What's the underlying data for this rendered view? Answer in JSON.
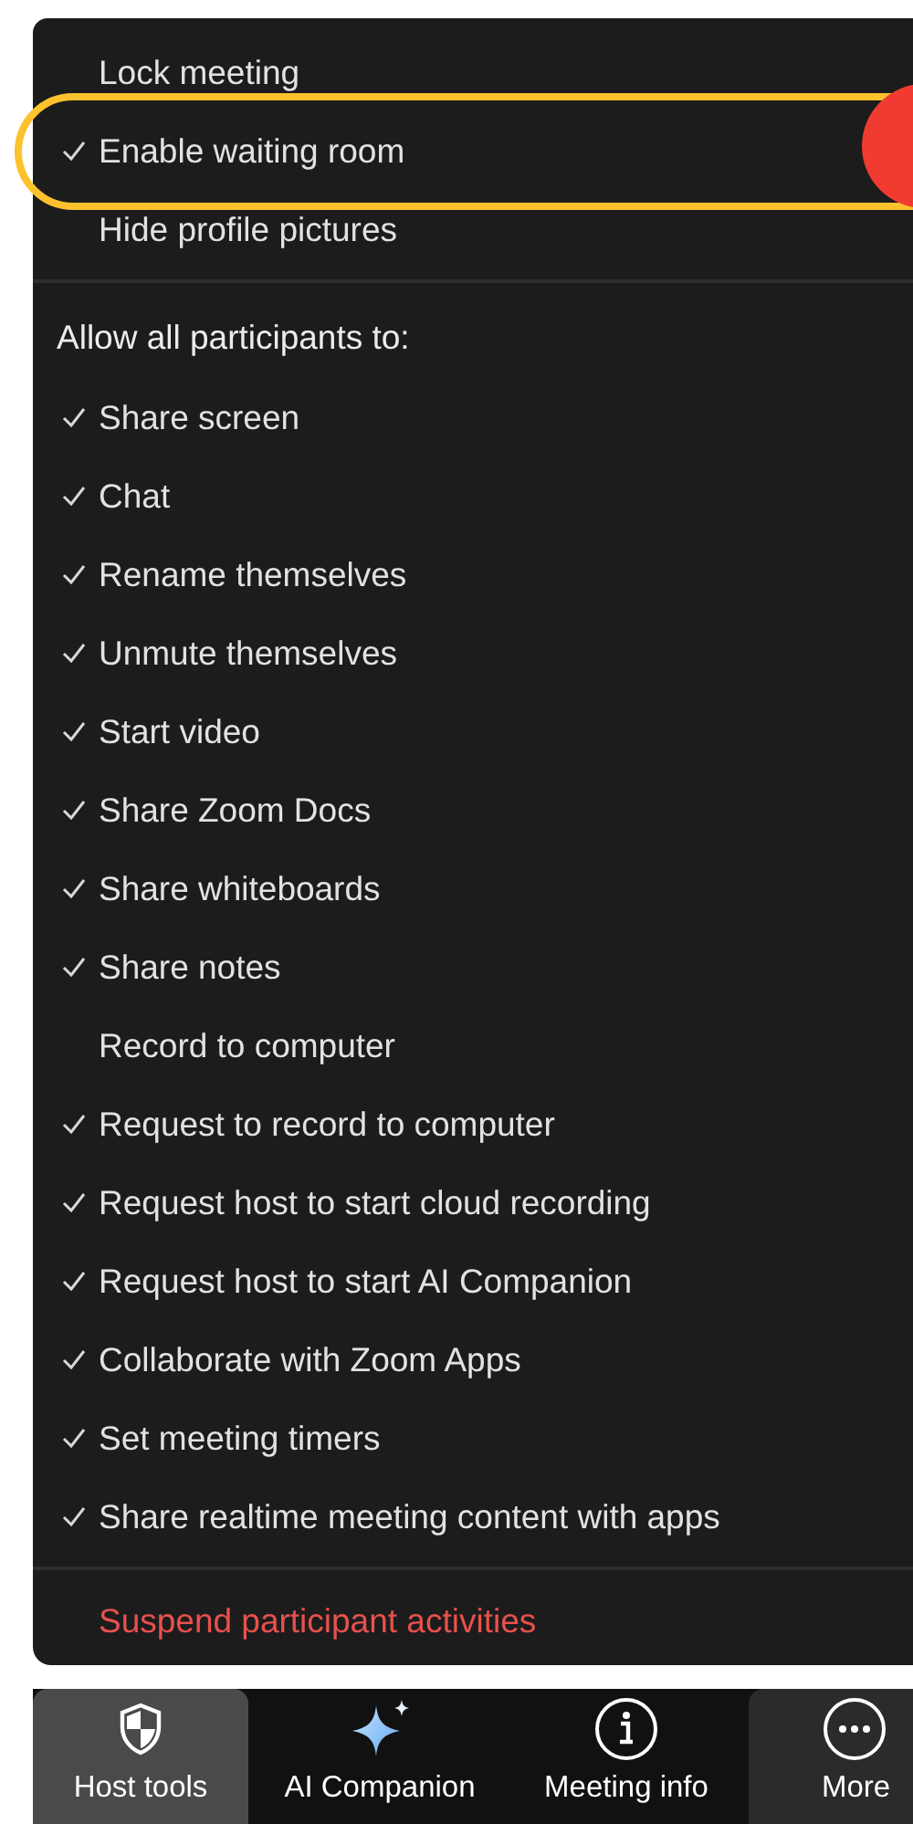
{
  "meeting_options": [
    {
      "label": "Lock meeting",
      "checked": false
    },
    {
      "label": "Enable waiting room",
      "checked": true
    },
    {
      "label": "Hide profile pictures",
      "checked": false
    }
  ],
  "participants_section": {
    "heading": "Allow all participants to:",
    "items": [
      {
        "label": "Share screen",
        "checked": true
      },
      {
        "label": "Chat",
        "checked": true
      },
      {
        "label": "Rename themselves",
        "checked": true
      },
      {
        "label": "Unmute themselves",
        "checked": true
      },
      {
        "label": "Start video",
        "checked": true
      },
      {
        "label": "Share Zoom Docs",
        "checked": true
      },
      {
        "label": "Share whiteboards",
        "checked": true
      },
      {
        "label": "Share notes",
        "checked": true
      },
      {
        "label": "Record to computer",
        "checked": false
      },
      {
        "label": "Request to record to computer",
        "checked": true
      },
      {
        "label": "Request host to start cloud recording",
        "checked": true
      },
      {
        "label": "Request host to start AI Companion",
        "checked": true
      },
      {
        "label": "Collaborate with Zoom Apps",
        "checked": true
      },
      {
        "label": "Set meeting timers",
        "checked": true
      },
      {
        "label": "Share realtime meeting content with apps",
        "checked": true
      }
    ]
  },
  "danger_action": "Suspend participant activities",
  "toolbar": [
    {
      "kind": "shield",
      "label": "Host tools",
      "selected": true
    },
    {
      "kind": "sparkle",
      "label": "AI Companion",
      "selected": false
    },
    {
      "kind": "info",
      "label": "Meeting info",
      "selected": false
    },
    {
      "kind": "more",
      "label": "More",
      "selected": false,
      "hovered": true
    }
  ]
}
